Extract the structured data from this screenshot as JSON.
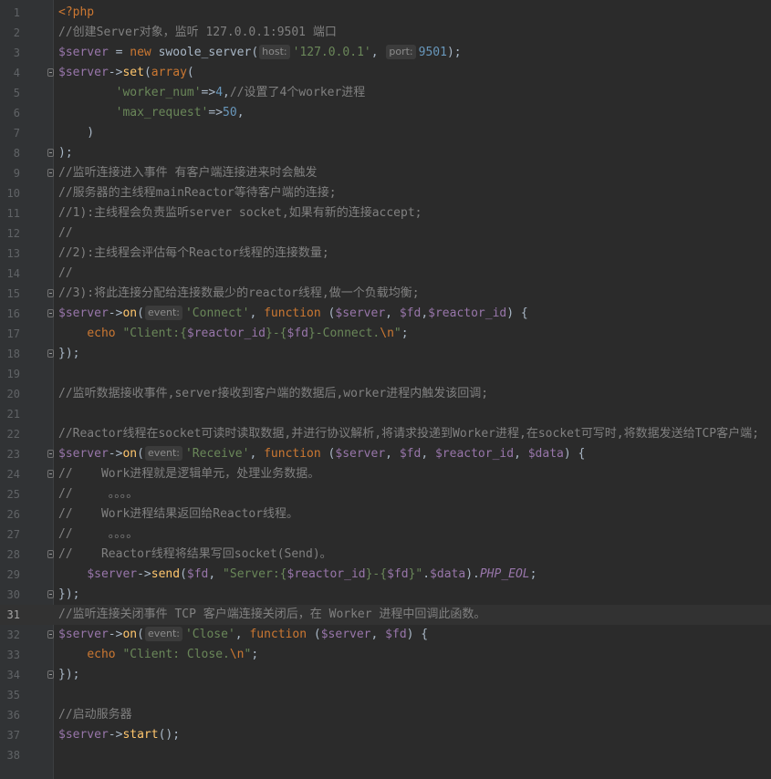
{
  "editor": {
    "language": "php",
    "current_line": 31,
    "colors": {
      "background": "#2b2b2b",
      "gutter": "#313335",
      "line_number": "#606366",
      "keyword": "#cc7832",
      "variable": "#9876aa",
      "function": "#ffc66d",
      "string": "#6a8759",
      "number": "#6897bb",
      "comment": "#808080",
      "plain": "#a9b7c6"
    },
    "lines": [
      {
        "n": "1",
        "fold": false,
        "tokens": [
          {
            "t": "<?php",
            "c": "kw"
          }
        ]
      },
      {
        "n": "2",
        "fold": false,
        "tokens": [
          {
            "t": "//创建Server对象，监听 127.0.0.1:9501 端口",
            "c": "cmt"
          }
        ]
      },
      {
        "n": "3",
        "fold": false,
        "tokens": [
          {
            "t": "$server",
            "c": "var"
          },
          {
            "t": " = ",
            "c": "plain"
          },
          {
            "t": "new",
            "c": "kw"
          },
          {
            "t": " swoole_server(",
            "c": "plain"
          },
          {
            "t": "host:",
            "c": "hint"
          },
          {
            "t": "'127.0.0.1'",
            "c": "str"
          },
          {
            "t": ", ",
            "c": "plain"
          },
          {
            "t": "port:",
            "c": "hint"
          },
          {
            "t": "9501",
            "c": "num"
          },
          {
            "t": ");",
            "c": "plain"
          }
        ]
      },
      {
        "n": "4",
        "fold": true,
        "tokens": [
          {
            "t": "$server",
            "c": "var"
          },
          {
            "t": "->",
            "c": "plain"
          },
          {
            "t": "set",
            "c": "fn"
          },
          {
            "t": "(",
            "c": "plain"
          },
          {
            "t": "array",
            "c": "kw"
          },
          {
            "t": "(",
            "c": "plain"
          }
        ]
      },
      {
        "n": "5",
        "fold": false,
        "tokens": [
          {
            "t": "        ",
            "c": "plain"
          },
          {
            "t": "'worker_num'",
            "c": "str"
          },
          {
            "t": "=>",
            "c": "plain"
          },
          {
            "t": "4",
            "c": "num"
          },
          {
            "t": ",",
            "c": "plain"
          },
          {
            "t": "//设置了4个worker进程",
            "c": "cmt"
          }
        ]
      },
      {
        "n": "6",
        "fold": false,
        "tokens": [
          {
            "t": "        ",
            "c": "plain"
          },
          {
            "t": "'max_request'",
            "c": "str"
          },
          {
            "t": "=>",
            "c": "plain"
          },
          {
            "t": "50",
            "c": "num"
          },
          {
            "t": ",",
            "c": "plain"
          }
        ]
      },
      {
        "n": "7",
        "fold": false,
        "tokens": [
          {
            "t": "    )",
            "c": "plain"
          }
        ]
      },
      {
        "n": "8",
        "fold": true,
        "tokens": [
          {
            "t": ");",
            "c": "plain"
          }
        ]
      },
      {
        "n": "9",
        "fold": true,
        "tokens": [
          {
            "t": "//监听连接进入事件 有客户端连接进来时会触发",
            "c": "cmt"
          }
        ]
      },
      {
        "n": "10",
        "fold": false,
        "tokens": [
          {
            "t": "//服务器的主线程mainReactor等待客户端的连接;",
            "c": "cmt"
          }
        ]
      },
      {
        "n": "11",
        "fold": false,
        "tokens": [
          {
            "t": "//1):主线程会负责监听server socket,如果有新的连接accept;",
            "c": "cmt"
          }
        ]
      },
      {
        "n": "12",
        "fold": false,
        "tokens": [
          {
            "t": "//",
            "c": "cmt"
          }
        ]
      },
      {
        "n": "13",
        "fold": false,
        "tokens": [
          {
            "t": "//2):主线程会评估每个Reactor线程的连接数量;",
            "c": "cmt"
          }
        ]
      },
      {
        "n": "14",
        "fold": false,
        "tokens": [
          {
            "t": "//",
            "c": "cmt"
          }
        ]
      },
      {
        "n": "15",
        "fold": true,
        "tokens": [
          {
            "t": "//3):将此连接分配给连接数最少的reactor线程,做一个负载均衡;",
            "c": "cmt"
          }
        ]
      },
      {
        "n": "16",
        "fold": true,
        "tokens": [
          {
            "t": "$server",
            "c": "var"
          },
          {
            "t": "->",
            "c": "plain"
          },
          {
            "t": "on",
            "c": "fn"
          },
          {
            "t": "(",
            "c": "plain"
          },
          {
            "t": "event:",
            "c": "hint"
          },
          {
            "t": "'Connect'",
            "c": "str"
          },
          {
            "t": ", ",
            "c": "plain"
          },
          {
            "t": "function",
            "c": "kw"
          },
          {
            "t": " (",
            "c": "plain"
          },
          {
            "t": "$server",
            "c": "var"
          },
          {
            "t": ", ",
            "c": "plain"
          },
          {
            "t": "$fd",
            "c": "var"
          },
          {
            "t": ",",
            "c": "plain"
          },
          {
            "t": "$reactor_id",
            "c": "var"
          },
          {
            "t": ") {",
            "c": "plain"
          }
        ]
      },
      {
        "n": "17",
        "fold": false,
        "tokens": [
          {
            "t": "    ",
            "c": "plain"
          },
          {
            "t": "echo",
            "c": "kw"
          },
          {
            "t": " ",
            "c": "plain"
          },
          {
            "t": "\"Client:{",
            "c": "str"
          },
          {
            "t": "$reactor_id",
            "c": "var"
          },
          {
            "t": "}-{",
            "c": "str"
          },
          {
            "t": "$fd",
            "c": "var"
          },
          {
            "t": "}-Connect.",
            "c": "str"
          },
          {
            "t": "\\n",
            "c": "esc"
          },
          {
            "t": "\"",
            "c": "str"
          },
          {
            "t": ";",
            "c": "plain"
          }
        ]
      },
      {
        "n": "18",
        "fold": true,
        "tokens": [
          {
            "t": "});",
            "c": "plain"
          }
        ]
      },
      {
        "n": "19",
        "fold": false,
        "tokens": []
      },
      {
        "n": "20",
        "fold": false,
        "tokens": [
          {
            "t": "//监听数据接收事件,server接收到客户端的数据后,worker进程内触发该回调;",
            "c": "cmt"
          }
        ]
      },
      {
        "n": "21",
        "fold": false,
        "tokens": []
      },
      {
        "n": "22",
        "fold": false,
        "tokens": [
          {
            "t": "//Reactor线程在socket可读时读取数据,并进行协议解析,将请求投递到Worker进程,在socket可写时,将数据发送给TCP客户端;",
            "c": "cmt"
          }
        ]
      },
      {
        "n": "23",
        "fold": true,
        "tokens": [
          {
            "t": "$server",
            "c": "var"
          },
          {
            "t": "->",
            "c": "plain"
          },
          {
            "t": "on",
            "c": "fn"
          },
          {
            "t": "(",
            "c": "plain"
          },
          {
            "t": "event:",
            "c": "hint"
          },
          {
            "t": "'Receive'",
            "c": "str"
          },
          {
            "t": ", ",
            "c": "plain"
          },
          {
            "t": "function",
            "c": "kw"
          },
          {
            "t": " (",
            "c": "plain"
          },
          {
            "t": "$server",
            "c": "var"
          },
          {
            "t": ", ",
            "c": "plain"
          },
          {
            "t": "$fd",
            "c": "var"
          },
          {
            "t": ", ",
            "c": "plain"
          },
          {
            "t": "$reactor_id",
            "c": "var"
          },
          {
            "t": ", ",
            "c": "plain"
          },
          {
            "t": "$data",
            "c": "var"
          },
          {
            "t": ") {",
            "c": "plain"
          }
        ]
      },
      {
        "n": "24",
        "fold": true,
        "tokens": [
          {
            "t": "//    Work进程就是逻辑单元，处理业务数据。",
            "c": "cmt"
          }
        ]
      },
      {
        "n": "25",
        "fold": false,
        "tokens": [
          {
            "t": "//     。。。。",
            "c": "cmt"
          }
        ]
      },
      {
        "n": "26",
        "fold": false,
        "tokens": [
          {
            "t": "//    Work进程结果返回给Reactor线程。",
            "c": "cmt"
          }
        ]
      },
      {
        "n": "27",
        "fold": false,
        "tokens": [
          {
            "t": "//     。。。。",
            "c": "cmt"
          }
        ]
      },
      {
        "n": "28",
        "fold": true,
        "tokens": [
          {
            "t": "//    Reactor线程将结果写回socket(Send)。",
            "c": "cmt"
          }
        ]
      },
      {
        "n": "29",
        "fold": false,
        "tokens": [
          {
            "t": "    ",
            "c": "plain"
          },
          {
            "t": "$server",
            "c": "var"
          },
          {
            "t": "->",
            "c": "plain"
          },
          {
            "t": "send",
            "c": "fn"
          },
          {
            "t": "(",
            "c": "plain"
          },
          {
            "t": "$fd",
            "c": "var"
          },
          {
            "t": ", ",
            "c": "plain"
          },
          {
            "t": "\"Server:{",
            "c": "str"
          },
          {
            "t": "$reactor_id",
            "c": "var"
          },
          {
            "t": "}-{",
            "c": "str"
          },
          {
            "t": "$fd",
            "c": "var"
          },
          {
            "t": "}\"",
            "c": "str"
          },
          {
            "t": ".",
            "c": "plain"
          },
          {
            "t": "$data",
            "c": "var"
          },
          {
            "t": ").",
            "c": "plain"
          },
          {
            "t": "PHP_EOL",
            "c": "const"
          },
          {
            "t": ";",
            "c": "plain"
          }
        ]
      },
      {
        "n": "30",
        "fold": true,
        "tokens": [
          {
            "t": "});",
            "c": "plain"
          }
        ]
      },
      {
        "n": "31",
        "fold": false,
        "tokens": [
          {
            "t": "//监听连接关闭事件 TCP 客户端连接关闭后，在 Worker 进程中回调此函数。",
            "c": "cmt"
          }
        ]
      },
      {
        "n": "32",
        "fold": true,
        "tokens": [
          {
            "t": "$server",
            "c": "var"
          },
          {
            "t": "->",
            "c": "plain"
          },
          {
            "t": "on",
            "c": "fn"
          },
          {
            "t": "(",
            "c": "plain"
          },
          {
            "t": "event:",
            "c": "hint"
          },
          {
            "t": "'Close'",
            "c": "str"
          },
          {
            "t": ", ",
            "c": "plain"
          },
          {
            "t": "function",
            "c": "kw"
          },
          {
            "t": " (",
            "c": "plain"
          },
          {
            "t": "$server",
            "c": "var"
          },
          {
            "t": ", ",
            "c": "plain"
          },
          {
            "t": "$fd",
            "c": "var"
          },
          {
            "t": ") {",
            "c": "plain"
          }
        ]
      },
      {
        "n": "33",
        "fold": false,
        "tokens": [
          {
            "t": "    ",
            "c": "plain"
          },
          {
            "t": "echo",
            "c": "kw"
          },
          {
            "t": " ",
            "c": "plain"
          },
          {
            "t": "\"Client: Close.",
            "c": "str"
          },
          {
            "t": "\\n",
            "c": "esc"
          },
          {
            "t": "\"",
            "c": "str"
          },
          {
            "t": ";",
            "c": "plain"
          }
        ]
      },
      {
        "n": "34",
        "fold": true,
        "tokens": [
          {
            "t": "});",
            "c": "plain"
          }
        ]
      },
      {
        "n": "35",
        "fold": false,
        "tokens": []
      },
      {
        "n": "36",
        "fold": false,
        "tokens": [
          {
            "t": "//启动服务器",
            "c": "cmt"
          }
        ]
      },
      {
        "n": "37",
        "fold": false,
        "tokens": [
          {
            "t": "$server",
            "c": "var"
          },
          {
            "t": "->",
            "c": "plain"
          },
          {
            "t": "start",
            "c": "fn"
          },
          {
            "t": "();",
            "c": "plain"
          }
        ]
      },
      {
        "n": "38",
        "fold": false,
        "tokens": []
      }
    ]
  }
}
